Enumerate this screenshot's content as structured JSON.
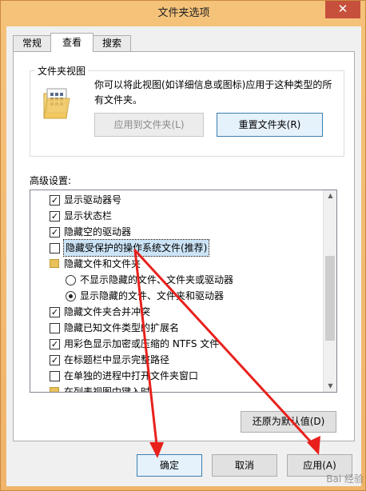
{
  "window": {
    "title": "文件夹选项",
    "close_glyph": "✕"
  },
  "tabs": [
    {
      "label": "常规"
    },
    {
      "label": "查看"
    },
    {
      "label": "搜索"
    }
  ],
  "folder_views": {
    "group_title": "文件夹视图",
    "description": "你可以将此视图(如详细信息或图标)应用于这种类型的所有文件夹。",
    "apply_button": "应用到文件夹(L)",
    "reset_button": "重置文件夹(R)"
  },
  "advanced": {
    "label": "高级设置:",
    "items": [
      {
        "type": "checkbox",
        "checked": true,
        "label": "显示驱动器号"
      },
      {
        "type": "checkbox",
        "checked": true,
        "label": "显示状态栏"
      },
      {
        "type": "checkbox",
        "checked": true,
        "label": "隐藏空的驱动器"
      },
      {
        "type": "checkbox",
        "checked": false,
        "label": "隐藏受保护的操作系统文件(推荐)",
        "selected": true
      },
      {
        "type": "folder",
        "label": "隐藏文件和文件夹"
      },
      {
        "type": "radio",
        "checked": false,
        "label": "不显示隐藏的文件、文件夹或驱动器"
      },
      {
        "type": "radio",
        "checked": true,
        "label": "显示隐藏的文件、文件夹和驱动器"
      },
      {
        "type": "checkbox",
        "checked": true,
        "label": "隐藏文件夹合并冲突"
      },
      {
        "type": "checkbox",
        "checked": false,
        "label": "隐藏已知文件类型的扩展名"
      },
      {
        "type": "checkbox",
        "checked": true,
        "label": "用彩色显示加密或压缩的 NTFS 文件"
      },
      {
        "type": "checkbox",
        "checked": true,
        "label": "在标题栏中显示完整路径"
      },
      {
        "type": "checkbox",
        "checked": false,
        "label": "在单独的进程中打开文件夹窗口"
      },
      {
        "type": "folder",
        "label": "在列表视图中键入时"
      }
    ],
    "restore_button": "还原为默认值(D)"
  },
  "footer": {
    "ok_button": "确定",
    "cancel_button": "取消",
    "apply_button": "应用(A)"
  },
  "watermark": "Bai 经验",
  "colors": {
    "arrow": "#e8201c",
    "selection": "#cce4f7"
  }
}
